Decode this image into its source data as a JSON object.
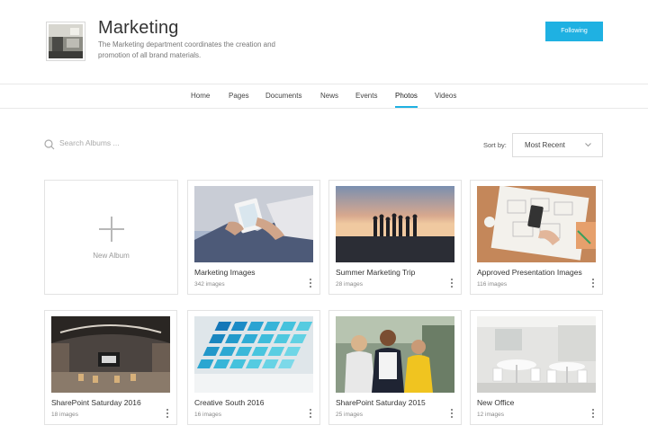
{
  "site": {
    "title": "Marketing",
    "description": "The Marketing department coordinates the creation and promotion of all brand materials.",
    "follow_label": "Following"
  },
  "nav": {
    "tabs": [
      "Home",
      "Pages",
      "Documents",
      "News",
      "Events",
      "Photos",
      "Videos"
    ],
    "active": "Photos"
  },
  "search": {
    "placeholder": "Search Albums ..."
  },
  "sort": {
    "label": "Sort by:",
    "value": "Most Recent"
  },
  "new_album": {
    "label": "New Album"
  },
  "albums": [
    {
      "title": "Marketing Images",
      "count": "342 images",
      "photo": "tablet-hands"
    },
    {
      "title": "Summer Marketing Trip",
      "count": "28 images",
      "photo": "beach-sunset"
    },
    {
      "title": "Approved Presentation Images",
      "count": "116 images",
      "photo": "desk-sketches"
    },
    {
      "title": "SharePoint Saturday 2016",
      "count": "18 images",
      "photo": "event-hall"
    },
    {
      "title": "Creative South 2016",
      "count": "16 images",
      "photo": "color-swatches"
    },
    {
      "title": "SharePoint Saturday 2015",
      "count": "25 images",
      "photo": "three-people"
    },
    {
      "title": "New Office",
      "count": "12 images",
      "photo": "white-office"
    }
  ],
  "colors": {
    "accent": "#1fb1e2",
    "border": "#e3e3e3"
  }
}
